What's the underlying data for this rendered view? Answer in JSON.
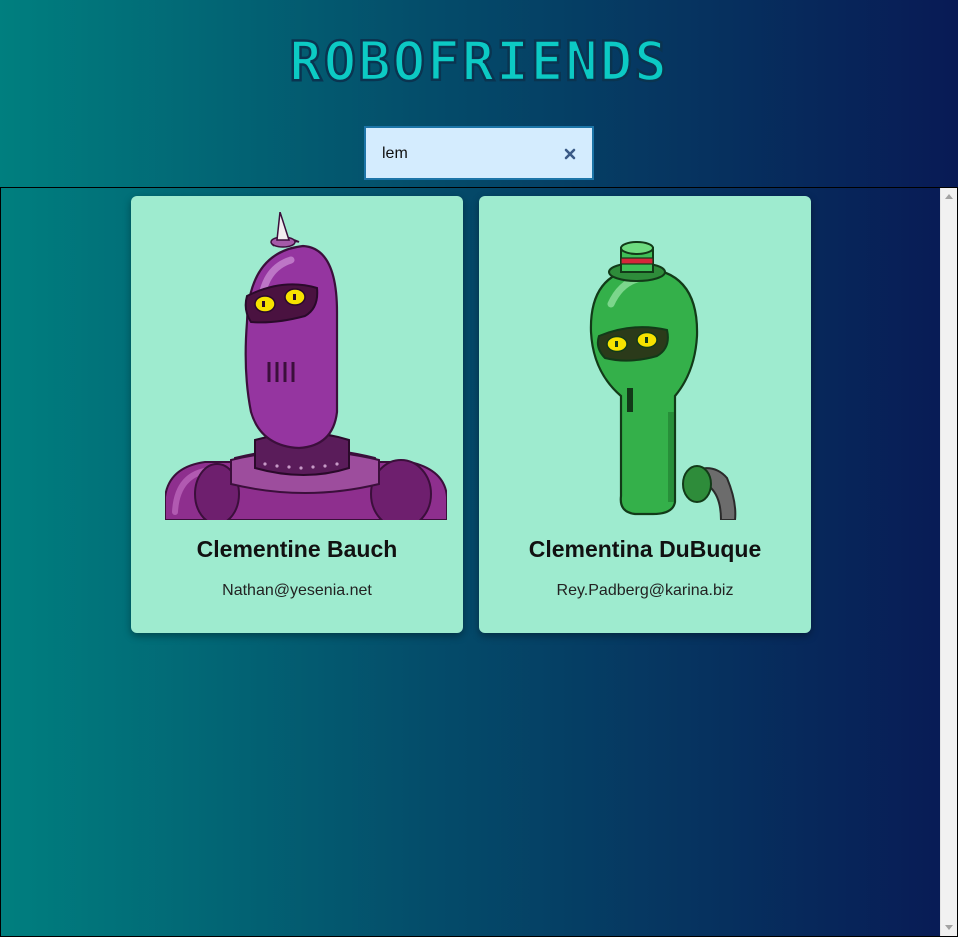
{
  "app": {
    "title": "ROBOFRIENDS"
  },
  "search": {
    "value": "lem",
    "clear_icon": "close-icon"
  },
  "cards": [
    {
      "name": "Clementine Bauch",
      "email": "Nathan@yesenia.net",
      "robot_color": "#8e2f8e"
    },
    {
      "name": "Clementina DuBuque",
      "email": "Rey.Padberg@karina.biz",
      "robot_color": "#2ea84a"
    }
  ],
  "colors": {
    "card_background": "#9eebcf",
    "title": "#0ccac4",
    "search_background": "#d4ecfe"
  }
}
